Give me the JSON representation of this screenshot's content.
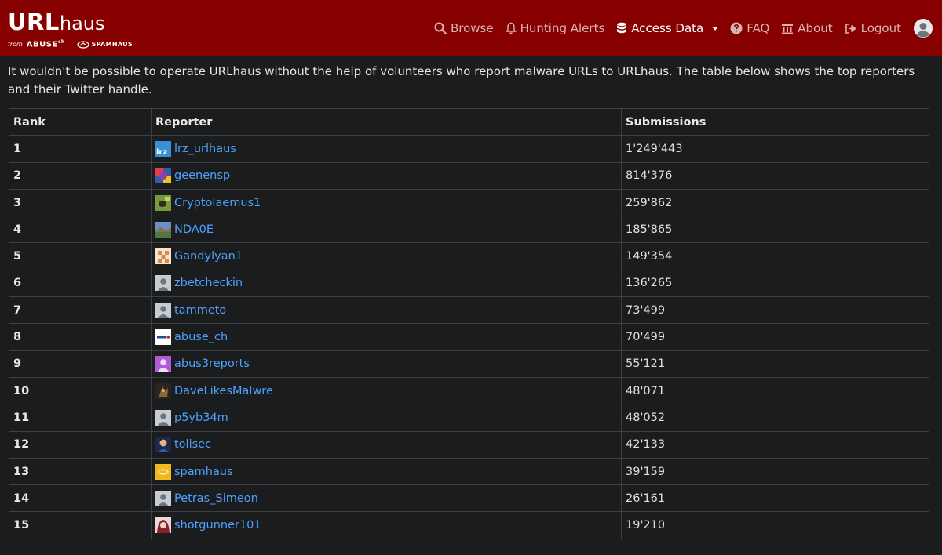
{
  "brand": {
    "title_bold": "URL",
    "title_light": "haus",
    "from": "from",
    "abuse": "ABUSE",
    "abuse_sup": "ch",
    "spamhaus": "SPAMHAUS"
  },
  "nav": {
    "browse": "Browse",
    "hunting_alerts": "Hunting Alerts",
    "access_data": "Access Data",
    "faq": "FAQ",
    "about": "About",
    "logout": "Logout"
  },
  "intro": "It wouldn't be possible to operate URLhaus without the help of volunteers who report malware URLs to URLhaus. The table below shows the top reporters and their Twitter handle.",
  "table": {
    "headers": {
      "rank": "Rank",
      "reporter": "Reporter",
      "submissions": "Submissions"
    },
    "rows": [
      {
        "rank": "1",
        "reporter": "lrz_urlhaus",
        "submissions": "1'249'443",
        "avatar": "lrz"
      },
      {
        "rank": "2",
        "reporter": "geenensp",
        "submissions": "814'376",
        "avatar": "colorful"
      },
      {
        "rank": "3",
        "reporter": "Cryptolaemus1",
        "submissions": "259'862",
        "avatar": "bug"
      },
      {
        "rank": "4",
        "reporter": "NDA0E",
        "submissions": "185'865",
        "avatar": "landscape"
      },
      {
        "rank": "5",
        "reporter": "Gandylyan1",
        "submissions": "149'354",
        "avatar": "pattern"
      },
      {
        "rank": "6",
        "reporter": "zbetcheckin",
        "submissions": "136'265",
        "avatar": "default"
      },
      {
        "rank": "7",
        "reporter": "tammeto",
        "submissions": "73'499",
        "avatar": "default"
      },
      {
        "rank": "8",
        "reporter": "abuse_ch",
        "submissions": "70'499",
        "avatar": "abuse"
      },
      {
        "rank": "9",
        "reporter": "abus3reports",
        "submissions": "55'121",
        "avatar": "purple"
      },
      {
        "rank": "10",
        "reporter": "DaveLikesMalwre",
        "submissions": "48'071",
        "avatar": "dark"
      },
      {
        "rank": "11",
        "reporter": "p5yb34m",
        "submissions": "48'052",
        "avatar": "default"
      },
      {
        "rank": "12",
        "reporter": "tolisec",
        "submissions": "42'133",
        "avatar": "person"
      },
      {
        "rank": "13",
        "reporter": "spamhaus",
        "submissions": "39'159",
        "avatar": "spamhaus"
      },
      {
        "rank": "14",
        "reporter": "Petras_Simeon",
        "submissions": "26'161",
        "avatar": "default"
      },
      {
        "rank": "15",
        "reporter": "shotgunner101",
        "submissions": "19'210",
        "avatar": "anime"
      }
    ]
  },
  "colors": {
    "navbar": "#870000",
    "background": "#1b1c1e",
    "link": "#4ea1ff"
  }
}
